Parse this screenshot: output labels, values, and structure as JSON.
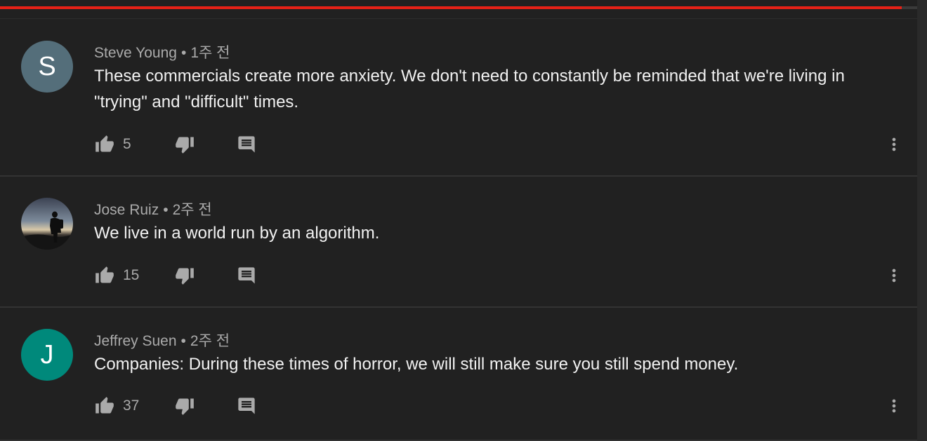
{
  "video": {
    "progress_fraction": 0.983
  },
  "comments": [
    {
      "author": "Steve Young",
      "time": "1주 전",
      "text": "These commercials create more anxiety.  We don't need to constantly be reminded that we're living in \"trying\" and \"difficult\" times.",
      "likes": "5",
      "avatar": {
        "type": "letter",
        "letter": "S",
        "color": "#546e7a"
      }
    },
    {
      "author": "Jose Ruiz",
      "time": "2주 전",
      "text": "We live in a world run by an algorithm.",
      "likes": "15",
      "avatar": {
        "type": "photo",
        "description_icon": "silhouette-photo-icon"
      }
    },
    {
      "author": "Jeffrey Suen",
      "time": "2주 전",
      "text": "Companies: During these times of horror, we will still make sure you still spend money.",
      "likes": "37",
      "avatar": {
        "type": "letter",
        "letter": "J",
        "color": "#00897b"
      }
    }
  ],
  "icons": {
    "like": "thumb-up-icon",
    "dislike": "thumb-down-icon",
    "reply": "comment-icon",
    "more": "more-vert-icon"
  },
  "colors": {
    "background": "#212121",
    "progress": "#e62117",
    "text_primary": "#f1f1f1",
    "text_secondary": "#aaaaaa",
    "icon": "#aaaaaa"
  }
}
